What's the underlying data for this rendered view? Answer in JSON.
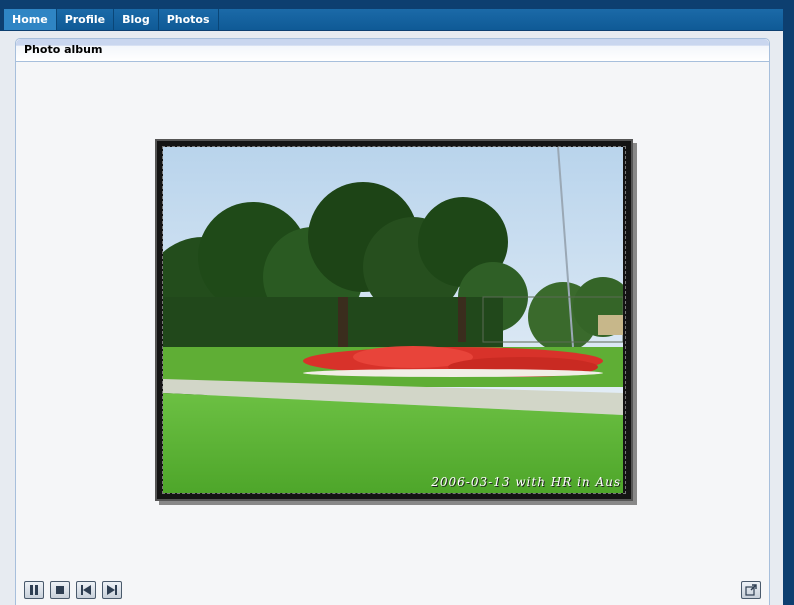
{
  "nav": {
    "items": [
      {
        "label": "Home",
        "active": true
      },
      {
        "label": "Profile",
        "active": false
      },
      {
        "label": "Blog",
        "active": false
      },
      {
        "label": "Photos",
        "active": false
      }
    ]
  },
  "panel": {
    "title": "Photo album"
  },
  "photo": {
    "caption": "2006-03-13 with HR in Aus"
  },
  "controls": {
    "pause_icon": "pause-icon",
    "stop_icon": "stop-icon",
    "previous_icon": "skip-previous-icon",
    "next_icon": "skip-next-icon",
    "expand_icon": "expand-icon"
  },
  "colors": {
    "nav_background": "#0d3f70",
    "nav_active": "#2f85c4",
    "panel_border": "#a7bfdc",
    "panel_background": "#f5f6f8"
  }
}
